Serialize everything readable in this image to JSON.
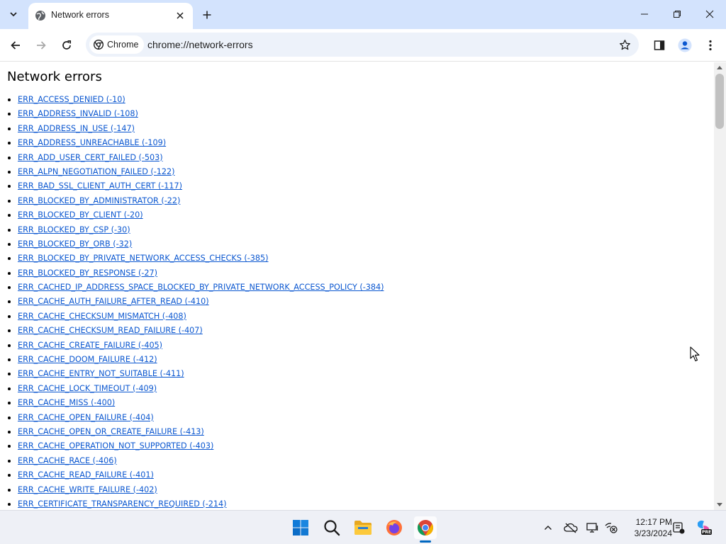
{
  "browser": {
    "tab": {
      "title": "Network errors"
    },
    "omnibox": {
      "chip_label": "Chrome",
      "url": "chrome://network-errors"
    }
  },
  "page": {
    "title": "Network errors",
    "errors": [
      "ERR_ACCESS_DENIED (-10)",
      "ERR_ADDRESS_INVALID (-108)",
      "ERR_ADDRESS_IN_USE (-147)",
      "ERR_ADDRESS_UNREACHABLE (-109)",
      "ERR_ADD_USER_CERT_FAILED (-503)",
      "ERR_ALPN_NEGOTIATION_FAILED (-122)",
      "ERR_BAD_SSL_CLIENT_AUTH_CERT (-117)",
      "ERR_BLOCKED_BY_ADMINISTRATOR (-22)",
      "ERR_BLOCKED_BY_CLIENT (-20)",
      "ERR_BLOCKED_BY_CSP (-30)",
      "ERR_BLOCKED_BY_ORB (-32)",
      "ERR_BLOCKED_BY_PRIVATE_NETWORK_ACCESS_CHECKS (-385)",
      "ERR_BLOCKED_BY_RESPONSE (-27)",
      "ERR_CACHED_IP_ADDRESS_SPACE_BLOCKED_BY_PRIVATE_NETWORK_ACCESS_POLICY (-384)",
      "ERR_CACHE_AUTH_FAILURE_AFTER_READ (-410)",
      "ERR_CACHE_CHECKSUM_MISMATCH (-408)",
      "ERR_CACHE_CHECKSUM_READ_FAILURE (-407)",
      "ERR_CACHE_CREATE_FAILURE (-405)",
      "ERR_CACHE_DOOM_FAILURE (-412)",
      "ERR_CACHE_ENTRY_NOT_SUITABLE (-411)",
      "ERR_CACHE_LOCK_TIMEOUT (-409)",
      "ERR_CACHE_MISS (-400)",
      "ERR_CACHE_OPEN_FAILURE (-404)",
      "ERR_CACHE_OPEN_OR_CREATE_FAILURE (-413)",
      "ERR_CACHE_OPERATION_NOT_SUPPORTED (-403)",
      "ERR_CACHE_RACE (-406)",
      "ERR_CACHE_READ_FAILURE (-401)",
      "ERR_CACHE_WRITE_FAILURE (-402)",
      "ERR_CERTIFICATE_TRANSPARENCY_REQUIRED (-214)"
    ]
  },
  "taskbar": {
    "clock": {
      "time": "12:17 PM",
      "date": "3/23/2024"
    },
    "copilot_badge": "PRE"
  },
  "icons": {
    "tab_search": "chevron-down-icon",
    "favicon": "globe-icon",
    "tab_close": "close-icon",
    "new_tab": "plus-icon",
    "back": "arrow-left-icon",
    "forward": "arrow-right-icon",
    "reload": "reload-icon",
    "bookmark": "star-icon",
    "side_panel": "side-panel-icon",
    "profile": "person-icon",
    "menu": "kebab-menu-icon"
  },
  "colors": {
    "tabstrip_bg": "#d3e3fd",
    "omnibox_bg": "#edf2fa",
    "link": "#0b57d0",
    "taskbar_bg": "#eef0f6",
    "accent": "#0067c0"
  }
}
